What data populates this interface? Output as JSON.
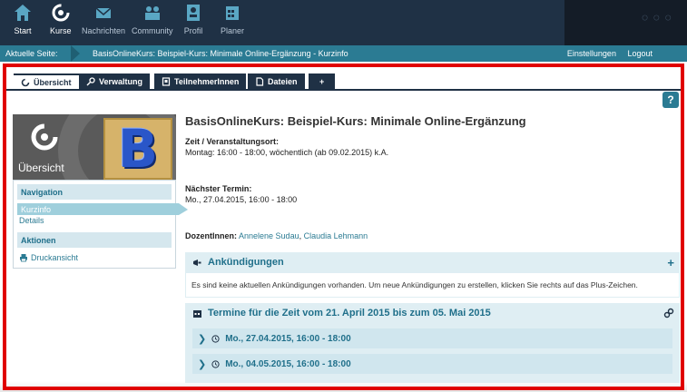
{
  "topnav": {
    "items": [
      {
        "label": "Start",
        "icon": "home-icon"
      },
      {
        "label": "Kurse",
        "icon": "courses-icon",
        "active": true
      },
      {
        "label": "Nachrichten",
        "icon": "mail-icon"
      },
      {
        "label": "Community",
        "icon": "community-icon"
      },
      {
        "label": "Profil",
        "icon": "profile-icon"
      },
      {
        "label": "Planer",
        "icon": "planner-icon"
      }
    ]
  },
  "breadcrumb": {
    "label": "Aktuelle Seite:",
    "path": "BasisOnlineKurs: Beispiel-Kurs: Minimale Online-Ergänzung - Kurzinfo",
    "settings": "Einstellungen",
    "logout": "Logout"
  },
  "tabs": [
    {
      "label": "Übersicht",
      "icon": "overview-icon",
      "active": true
    },
    {
      "label": "Verwaltung",
      "icon": "key-icon"
    },
    {
      "label": "TeilnehmerInnen",
      "icon": "people-icon"
    },
    {
      "label": "Dateien",
      "icon": "file-icon"
    },
    {
      "label": "+",
      "icon": ""
    }
  ],
  "help": "?",
  "sidebar": {
    "title": "Übersicht",
    "avatar_letter": "B",
    "navigation_heading": "Navigation",
    "links": [
      {
        "label": "Kurzinfo",
        "active": true
      },
      {
        "label": "Details"
      }
    ],
    "actions_heading": "Aktionen",
    "print_label": "Druckansicht"
  },
  "main": {
    "title": "BasisOnlineKurs: Beispiel-Kurs: Minimale Online-Ergänzung",
    "time_label": "Zeit / Veranstaltungsort:",
    "time_value": "Montag: 16:00 - 18:00, wöchentlich (ab 09.02.2015) k.A.",
    "next_label": "Nächster Termin:",
    "next_value": "Mo., 27.04.2015, 16:00 - 18:00",
    "lecturers_label": "DozentInnen:",
    "lecturer_1": "Annelene Sudau",
    "lecturer_sep": ",",
    "lecturer_2": "Claudia Lehmann",
    "announcements": {
      "title": "Ankündigungen",
      "body": "Es sind keine aktuellen Ankündigungen vorhanden. Um neue Ankündigungen zu erstellen, klicken Sie rechts auf das Plus-Zeichen.",
      "action": "+"
    },
    "dates": {
      "title": "Termine für die Zeit vom 21. April 2015 bis zum 05. Mai 2015",
      "items": [
        "Mo., 27.04.2015, 16:00 - 18:00",
        "Mo., 04.05.2015, 16:00 - 18:00"
      ]
    }
  },
  "colors": {
    "nav_dark": "#1f3145",
    "accent_teal": "#2b7b93",
    "panel_light": "#dfeef3",
    "highlight_red": "#e00000"
  }
}
